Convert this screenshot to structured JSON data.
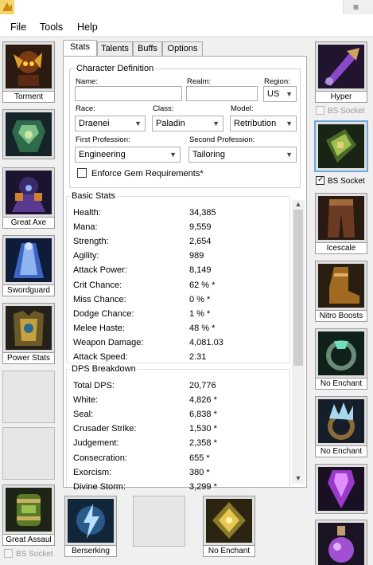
{
  "menu": [
    "File",
    "Tools",
    "Help"
  ],
  "window": {
    "minimize_glyph": "≡"
  },
  "left_slots": [
    {
      "caption": "Torment",
      "icon": "demon-warrior-icon"
    },
    {
      "caption": "",
      "icon": "green-armor-icon"
    },
    {
      "caption": "Great Axe",
      "icon": "mage-icon"
    },
    {
      "caption": "Swordguard",
      "icon": "blue-cloak-icon"
    },
    {
      "caption": "Power Stats",
      "icon": "gold-chestplate-icon"
    }
  ],
  "right_slots": [
    {
      "caption": "Hyper",
      "icon": "purple-blade-icon",
      "socket": "BS Socket",
      "socket_checked": false
    },
    {
      "caption": "",
      "icon": "green-bracer-icon",
      "socket": "BS Socket",
      "socket_checked": true
    },
    {
      "caption": "Icescale",
      "icon": "leather-leggings-icon"
    },
    {
      "caption": "Nitro Boosts",
      "icon": "orange-boot-icon"
    },
    {
      "caption": "No Enchant",
      "icon": "jeweled-ring-icon"
    },
    {
      "caption": "No Enchant",
      "icon": "crystal-ring-icon"
    },
    {
      "caption": "",
      "icon": "purple-gem-icon"
    },
    {
      "caption": "",
      "icon": "potion-icon"
    }
  ],
  "bottom_slots": [
    {
      "caption": "Great Assaul",
      "icon": "green-cylinder-icon",
      "socket": "BS Socket"
    },
    {
      "caption": "Berserking",
      "icon": "lightning-icon"
    },
    {
      "caption": "",
      "icon": ""
    },
    {
      "caption": "No Enchant",
      "icon": "golden-rune-icon"
    }
  ],
  "tabs": [
    "Stats",
    "Talents",
    "Buffs",
    "Options"
  ],
  "active_tab": "Stats",
  "character": {
    "title": "Character Definition",
    "name_label": "Name:",
    "name_value": "",
    "realm_label": "Realm:",
    "realm_value": "",
    "region_label": "Region:",
    "region_value": "US",
    "race_label": "Race:",
    "race_value": "Draenei",
    "class_label": "Class:",
    "class_value": "Paladin",
    "model_label": "Model:",
    "model_value": "Retribution",
    "first_prof_label": "First Profession:",
    "first_prof_value": "Engineering",
    "second_prof_label": "Second Profession:",
    "second_prof_value": "Tailoring",
    "enforce_label": "Enforce Gem Requirements*"
  },
  "basic_stats": {
    "title": "Basic Stats",
    "rows": [
      {
        "k": "Health:",
        "v": "34,385"
      },
      {
        "k": "Mana:",
        "v": "9,559"
      },
      {
        "k": "Strength:",
        "v": "2,654"
      },
      {
        "k": "Agility:",
        "v": "989"
      },
      {
        "k": "Attack Power:",
        "v": "8,149"
      },
      {
        "k": "Crit Chance:",
        "v": "62 % *"
      },
      {
        "k": "Miss Chance:",
        "v": "0 % *"
      },
      {
        "k": "Dodge Chance:",
        "v": "1 % *"
      },
      {
        "k": "Melee Haste:",
        "v": "48 % *"
      },
      {
        "k": "Weapon Damage:",
        "v": "4,081.03"
      },
      {
        "k": "Attack Speed:",
        "v": "2.31"
      }
    ]
  },
  "dps": {
    "title": "DPS Breakdown",
    "rows": [
      {
        "k": "Total DPS:",
        "v": "20,776"
      },
      {
        "k": "White:",
        "v": "4,826 *"
      },
      {
        "k": "Seal:",
        "v": "6,838 *"
      },
      {
        "k": "Crusader Strike:",
        "v": "1,530 *"
      },
      {
        "k": "Judgement:",
        "v": "2,358 *"
      },
      {
        "k": "Consecration:",
        "v": "655 *"
      },
      {
        "k": "Exorcism:",
        "v": "380 *"
      },
      {
        "k": "Divine Storm:",
        "v": "3,299 *"
      }
    ]
  }
}
